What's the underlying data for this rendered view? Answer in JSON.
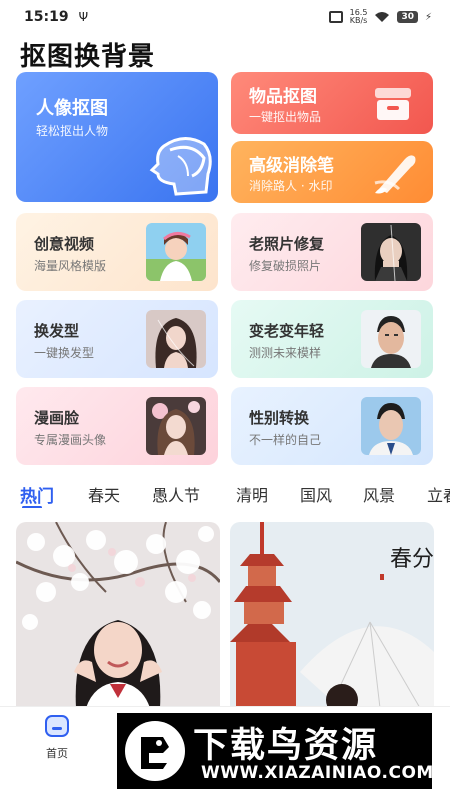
{
  "status_bar": {
    "time": "15:19",
    "usb_icon": "usb-icon",
    "net_speed_value": "16.5",
    "net_speed_unit": "KB/s",
    "battery": "30"
  },
  "page": {
    "title": "抠图换背景"
  },
  "hero": {
    "portrait": {
      "title": "人像抠图",
      "subtitle": "轻松抠出人物"
    },
    "object": {
      "title": "物品抠图",
      "subtitle": "一键抠出物品"
    },
    "erase": {
      "title": "高级消除笔",
      "subtitle": "消除路人 · 水印"
    }
  },
  "features": [
    {
      "title": "创意视频",
      "subtitle": "海量风格模版"
    },
    {
      "title": "老照片修复",
      "subtitle": "修复破损照片"
    },
    {
      "title": "换发型",
      "subtitle": "一键换发型"
    },
    {
      "title": "变老变年轻",
      "subtitle": "测测未来模样"
    },
    {
      "title": "漫画脸",
      "subtitle": "专属漫画头像"
    },
    {
      "title": "性别转换",
      "subtitle": "不一样的自己"
    }
  ],
  "tabs": [
    "热门",
    "春天",
    "愚人节",
    "清明",
    "国风",
    "风景",
    "立春"
  ],
  "active_tab": "热门",
  "template_badge": "春分",
  "bottom_nav": {
    "home": "首页"
  },
  "watermark": {
    "name": "下载鸟资源",
    "url": "WWW.XIAZAINIAO.COM"
  },
  "colors": {
    "accent": "#2f5ff0",
    "portrait": "#3a74f0",
    "object": "#f2574f",
    "erase": "#ff8c34"
  }
}
